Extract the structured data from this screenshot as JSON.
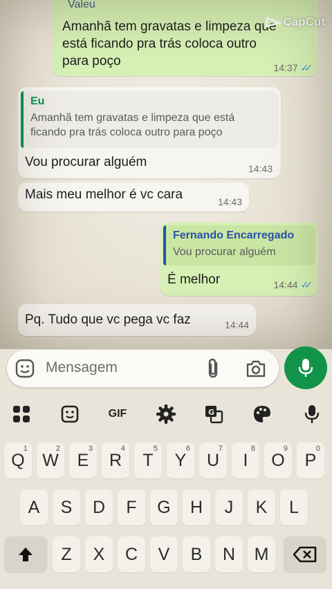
{
  "watermark": {
    "label": "CapCut"
  },
  "messages": [
    {
      "type": "outgoing",
      "quote_name": "Valeu",
      "text": "Amanhã tem gravatas e limpeza que está ficando pra trás coloca outro para poço",
      "line1": "Amanhã tem gravatas e limpeza que",
      "line2": "está ficando pra trás coloca outro",
      "line3": "para poço",
      "time": "14:37",
      "status": "read"
    },
    {
      "type": "incoming",
      "quote_name": "Eu",
      "quote_line1": "Amanhã tem gravatas e limpeza que está",
      "quote_line2": "ficando pra trás coloca outro para poço",
      "text": "Vou procurar alguém",
      "time": "14:43"
    },
    {
      "type": "incoming",
      "text": "Mais meu melhor é vc cara",
      "time": "14:43"
    },
    {
      "type": "outgoing",
      "quote_name": "Fernando Encarregado",
      "quote_text": "Vou procurar alguém",
      "text": "É melhor",
      "time": "14:44",
      "status": "read"
    },
    {
      "type": "incoming",
      "text": "Pq. Tudo que vc pega vc faz",
      "time": "14:44"
    }
  ],
  "composer": {
    "placeholder": "Mensagem"
  },
  "keyboard": {
    "toolbar": [
      "apps-icon",
      "sticker-icon",
      "GIF",
      "settings-icon",
      "translate-icon",
      "palette-icon",
      "mic-icon"
    ],
    "gif_label": "GIF",
    "row1": [
      "Q",
      "W",
      "E",
      "R",
      "T",
      "Y",
      "U",
      "I",
      "O",
      "P"
    ],
    "row1_nums": [
      "1",
      "2",
      "3",
      "4",
      "5",
      "6",
      "7",
      "8",
      "9",
      "0"
    ],
    "row2": [
      "A",
      "S",
      "D",
      "F",
      "G",
      "H",
      "J",
      "K",
      "L"
    ],
    "row3": [
      "Z",
      "X",
      "C",
      "V",
      "B",
      "N",
      "M"
    ]
  },
  "colors": {
    "outgoing": "#d6f0b5",
    "incoming": "#f7f5f0",
    "accent": "#12934a",
    "read_ticks": "#3b8fd9"
  }
}
